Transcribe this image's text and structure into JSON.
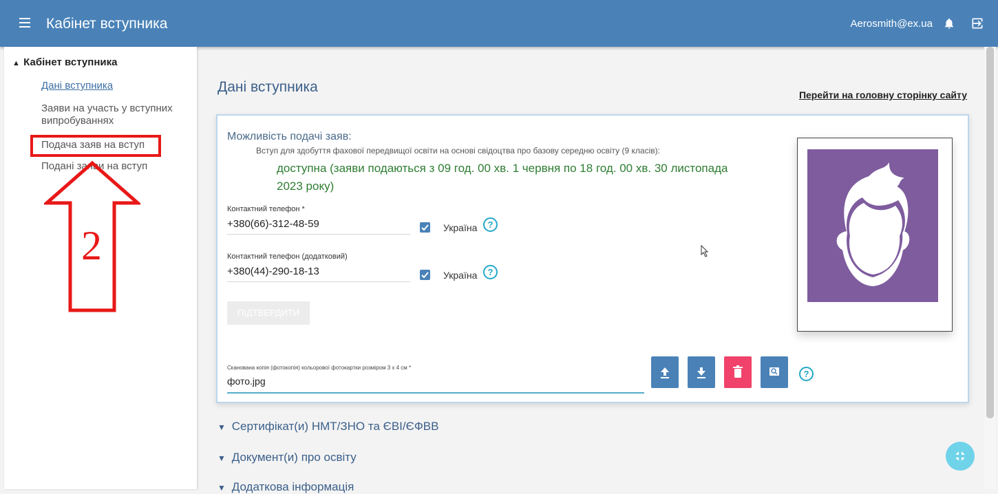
{
  "header": {
    "title": "Кабінет вступника",
    "user_email": "Aerosmith@ex.ua"
  },
  "sidebar": {
    "group_label": "Кабінет вступника",
    "items": [
      {
        "label": "Дані вступника"
      },
      {
        "label": "Заяви на участь у вступних випробуваннях"
      },
      {
        "label": "Подача заяв на вступ"
      },
      {
        "label": "Подані заяви на вступ"
      }
    ]
  },
  "annotation": {
    "number": "2",
    "color": "#e81818"
  },
  "main": {
    "page_title": "Дані вступника",
    "home_link": "Перейти на головну сторінку сайту",
    "application": {
      "heading": "Можливість подачі заяв:",
      "subtext": "Вступ для здобуття фахової передвищої освіти на основі свідоцтва про базову середню освіту (9 класів):",
      "status": "доступна (заяви подаються з 09 год. 00 хв. 1 червня по 18 год. 00 хв. 30 листопада 2023 року)"
    },
    "phone_primary": {
      "label": "Контактний телефон *",
      "value": "+380(66)-312-48-59",
      "country": "Україна",
      "checked": true
    },
    "phone_secondary": {
      "label": "Контактний телефон (додатковий)",
      "value": "+380(44)-290-18-13",
      "country": "Україна",
      "checked": true
    },
    "confirm_button": "ПІДТВЕРДИТИ",
    "photo": {
      "label": "Сканована копія (фотокопія) кольорової фотокартки розміром 3 х 4 см *",
      "value": "фото.jpg"
    },
    "sections": [
      {
        "label": "Сертифікат(и) НМТ/ЗНО та ЄВІ/ЄФВВ"
      },
      {
        "label": "Документ(и) про освіту"
      },
      {
        "label": "Додаткова інформація"
      }
    ]
  },
  "colors": {
    "header_bg": "#4a82b8",
    "status_green": "#2e7d32",
    "delete_button": "#f0426a",
    "avatar_bg": "#7e5c9e",
    "accent_cyan": "#22a8c8"
  },
  "icons": [
    "menu-icon",
    "bell-icon",
    "logout-icon",
    "chevron-up-icon",
    "help-icon",
    "upload-icon",
    "download-icon",
    "delete-icon",
    "preview-icon",
    "collapse-icon",
    "chevron-down-icon"
  ]
}
